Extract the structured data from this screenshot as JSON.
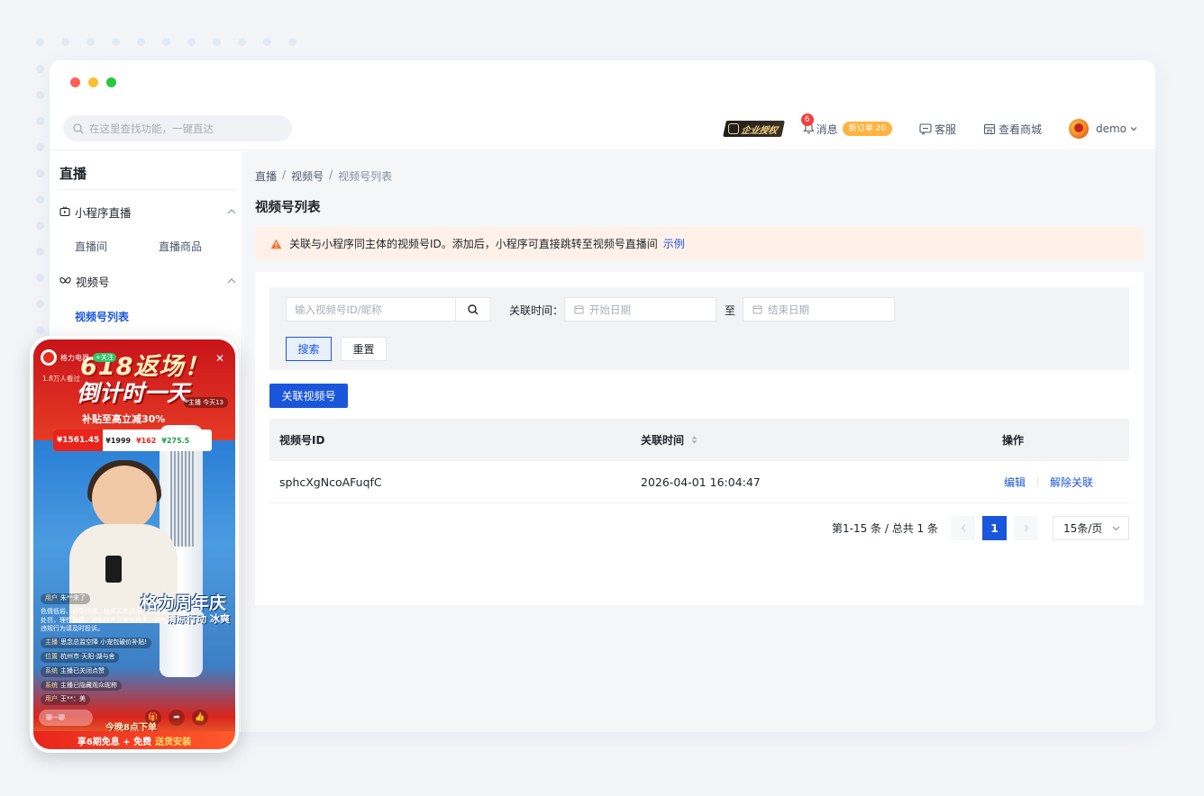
{
  "colors": {
    "accent": "#1a56db",
    "alert_bg": "#fff1ea",
    "alert_icon": "#f77234"
  },
  "topbar": {
    "search_placeholder": "在这里查找功能，一键直达",
    "enterprise_label": "企业授权",
    "messages": {
      "label": "消息",
      "count": "6",
      "order_tag": "新订单 20"
    },
    "service_label": "客服",
    "mall_label": "查看商城",
    "user_name": "demo"
  },
  "sidebar": {
    "title": "直播",
    "groups": [
      {
        "label": "小程序直播",
        "icon": "live-tv-icon",
        "items": [
          "直播间",
          "直播商品"
        ]
      },
      {
        "label": "视频号",
        "icon": "butterfly-icon",
        "items": [
          "视频号列表"
        ]
      }
    ]
  },
  "breadcrumb": [
    "直播",
    "视频号",
    "视频号列表"
  ],
  "page_title": "视频号列表",
  "alert": {
    "text": "关联与小程序同主体的视频号ID。添加后，小程序可直接跳转至视频号直播间",
    "link": "示例"
  },
  "filter": {
    "id_placeholder": "输入视频号ID/昵称",
    "time_label": "关联时间：",
    "start_placeholder": "开始日期",
    "to_label": "至",
    "end_placeholder": "结束日期",
    "search_button": "搜索",
    "reset_button": "重置"
  },
  "primary_button": "关联视频号",
  "table": {
    "columns": [
      "视频号ID",
      "关联时间",
      "操作"
    ],
    "rows": [
      {
        "id": "sphcXgNcoAFuqfC",
        "time": "2026-04-01 16:04:47",
        "actions": [
          "编辑",
          "解除关联"
        ]
      }
    ]
  },
  "pagination": {
    "summary": "第1-15 条 / 总共 1 条",
    "current_page": "1",
    "page_size": "15条/页"
  },
  "phone_preview": {
    "shop_name": "格力电器",
    "follow": "+关注",
    "viewers": "1.8万人看过",
    "headline": "618返场！",
    "countdown": "倒计时一天",
    "host_tag": "主播 今天13",
    "subsidy": "补贴至高立减30%",
    "price_main": "¥1561.45",
    "price_cells": [
      "¥1999",
      "¥162",
      "¥275.5"
    ],
    "anniversary": "格力周年庆",
    "anniversary_sub": "清凉行动 冰爽",
    "comments": [
      {
        "user": "用户",
        "text": "朱**来了"
      },
      {
        "user": "",
        "text": "色情低俗、诱导诈骗、抽奖买卖违规内容将被处罚，理性消费，避免财产及安全损失，如有违规行为请及时投诉。"
      },
      {
        "user": "主播",
        "text": "思念总监空降 小宠包破价补贴!"
      },
      {
        "user": "位置",
        "text": "杭州市·天阳·湖与舍"
      },
      {
        "user": "系统",
        "text": "主播已关闭点赞"
      },
      {
        "user": "系统",
        "text": "主播已隐藏观众昵称"
      },
      {
        "user": "用户",
        "text": "王**：美"
      }
    ],
    "chat_placeholder": "聊一聊",
    "tonight": "今晚8点下单",
    "footer": {
      "prefix": "享6期免息 + 免费",
      "highlight": "送货安装"
    }
  }
}
